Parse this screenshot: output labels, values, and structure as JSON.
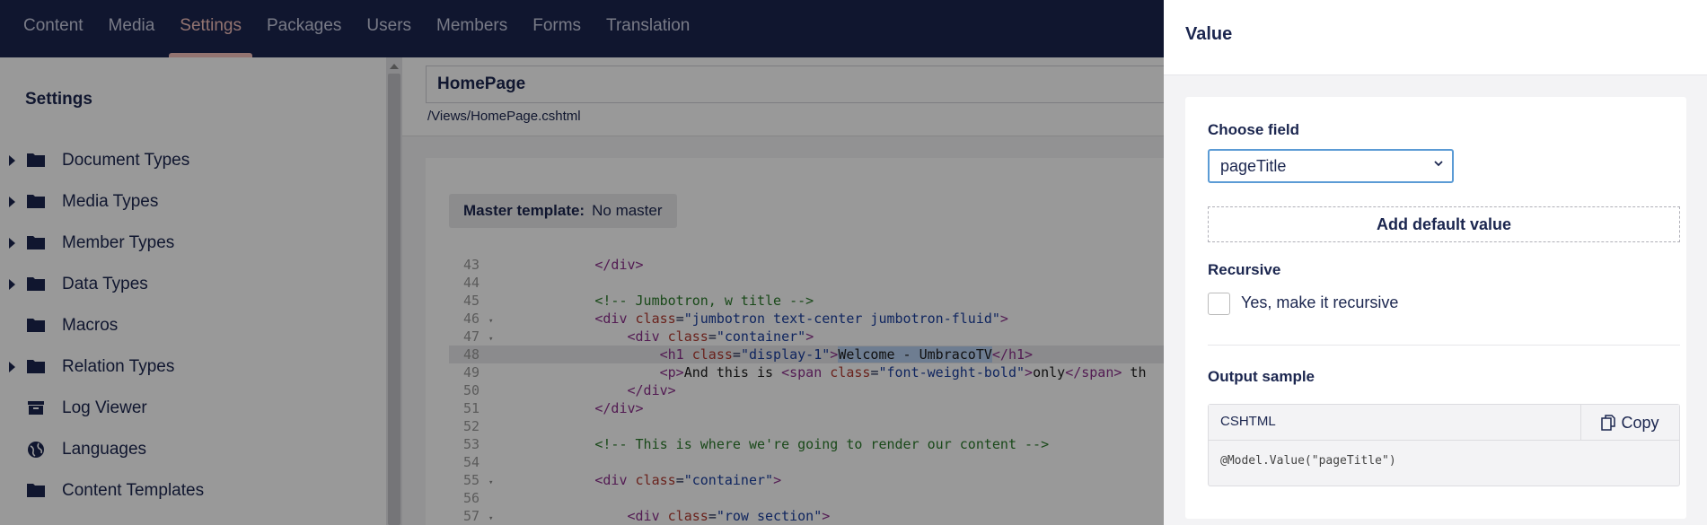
{
  "topnav": {
    "items": [
      {
        "label": "Content"
      },
      {
        "label": "Media"
      },
      {
        "label": "Settings",
        "active": true
      },
      {
        "label": "Packages"
      },
      {
        "label": "Users"
      },
      {
        "label": "Members"
      },
      {
        "label": "Forms"
      },
      {
        "label": "Translation"
      }
    ]
  },
  "sidebar": {
    "title": "Settings",
    "items": [
      {
        "label": "Document Types",
        "icon": "folder-icon",
        "expandable": true
      },
      {
        "label": "Media Types",
        "icon": "folder-icon",
        "expandable": true
      },
      {
        "label": "Member Types",
        "icon": "folder-icon",
        "expandable": true
      },
      {
        "label": "Data Types",
        "icon": "folder-icon",
        "expandable": true
      },
      {
        "label": "Macros",
        "icon": "folder-icon",
        "expandable": false
      },
      {
        "label": "Relation Types",
        "icon": "folder-icon",
        "expandable": true
      },
      {
        "label": "Log Viewer",
        "icon": "archive-icon",
        "expandable": false
      },
      {
        "label": "Languages",
        "icon": "globe-icon",
        "expandable": false
      },
      {
        "label": "Content Templates",
        "icon": "folder-icon",
        "expandable": false
      }
    ]
  },
  "editor": {
    "template_name": "HomePage",
    "path": "/Views/HomePage.cshtml",
    "master_label": "Master template:",
    "master_value": "No master",
    "code_lines": [
      {
        "n": "43",
        "fold": false,
        "html": "            <span class=\"t-tag\">&lt;/div&gt;</span>"
      },
      {
        "n": "44",
        "fold": false,
        "html": ""
      },
      {
        "n": "45",
        "fold": false,
        "html": "            <span class=\"t-com\">&lt;!-- Jumbotron, w title --&gt;</span>"
      },
      {
        "n": "46",
        "fold": true,
        "html": "            <span class=\"t-tag\">&lt;div</span> <span class=\"t-attr\">class</span>=<span class=\"t-str\">\"jumbotron text-center jumbotron-fluid\"</span><span class=\"t-tag\">&gt;</span>"
      },
      {
        "n": "47",
        "fold": true,
        "html": "                <span class=\"t-tag\">&lt;div</span> <span class=\"t-attr\">class</span>=<span class=\"t-str\">\"container\"</span><span class=\"t-tag\">&gt;</span>"
      },
      {
        "n": "48",
        "fold": false,
        "hl": true,
        "html": "                    <span class=\"t-tag\">&lt;h1</span> <span class=\"t-attr\">class</span>=<span class=\"t-str\">\"display-1\"</span><span class=\"t-tag\">&gt;</span><span class=\"t-txt sel\">Welcome - UmbracoTV</span><span class=\"t-tag\">&lt;/h1&gt;</span>"
      },
      {
        "n": "49",
        "fold": false,
        "html": "                    <span class=\"t-tag\">&lt;p&gt;</span><span class=\"t-txt\">And this is </span><span class=\"t-tag\">&lt;span</span> <span class=\"t-attr\">class</span>=<span class=\"t-str\">\"font-weight-bold\"</span><span class=\"t-tag\">&gt;</span><span class=\"t-txt\">only</span><span class=\"t-tag\">&lt;/span&gt;</span><span class=\"t-txt\"> th</span>"
      },
      {
        "n": "50",
        "fold": false,
        "html": "                <span class=\"t-tag\">&lt;/div&gt;</span>"
      },
      {
        "n": "51",
        "fold": false,
        "html": "            <span class=\"t-tag\">&lt;/div&gt;</span>"
      },
      {
        "n": "52",
        "fold": false,
        "html": ""
      },
      {
        "n": "53",
        "fold": false,
        "html": "            <span class=\"t-com\">&lt;!-- This is where we're going to render our content --&gt;</span>"
      },
      {
        "n": "54",
        "fold": false,
        "html": ""
      },
      {
        "n": "55",
        "fold": true,
        "html": "            <span class=\"t-tag\">&lt;div</span> <span class=\"t-attr\">class</span>=<span class=\"t-str\">\"container\"</span><span class=\"t-tag\">&gt;</span>"
      },
      {
        "n": "56",
        "fold": false,
        "html": ""
      },
      {
        "n": "57",
        "fold": true,
        "html": "                <span class=\"t-tag\">&lt;div</span> <span class=\"t-attr\">class</span>=<span class=\"t-str\">\"row section\"</span><span class=\"t-tag\">&gt;</span>"
      }
    ]
  },
  "panel": {
    "title": "Value",
    "choose_field_label": "Choose field",
    "selected_field": "pageTitle",
    "add_default_label": "Add default value",
    "recursive_label": "Recursive",
    "recursive_checkbox_label": "Yes, make it recursive",
    "output_sample_label": "Output sample",
    "sample_language": "CSHTML",
    "copy_label": "Copy",
    "sample_code": "@Model.Value(\"pageTitle\")"
  }
}
